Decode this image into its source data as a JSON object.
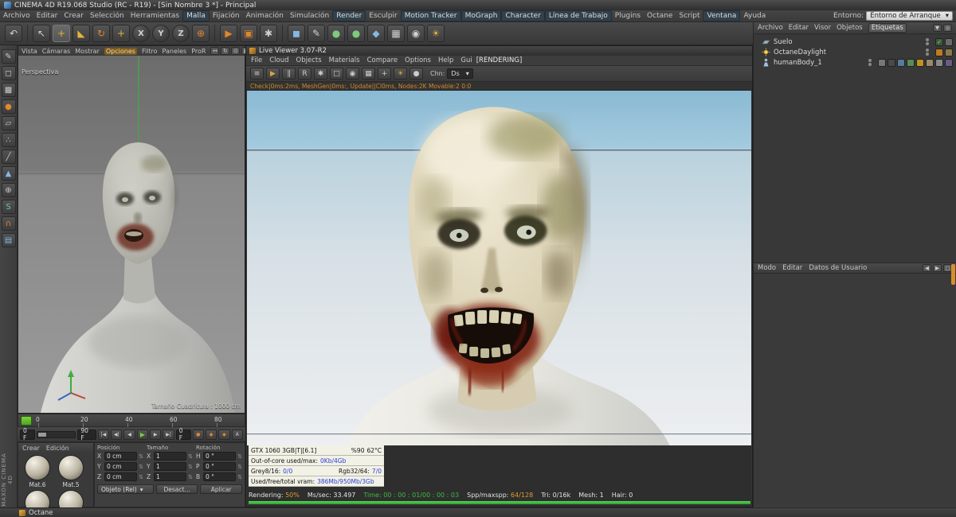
{
  "colors": {
    "accent_orange": "#d98e2b",
    "progress_green": "#2fb344",
    "value_blue": "#2a3fd4",
    "time_green": "#3dbb3d",
    "status_orange": "#cf8a28"
  },
  "title_bar": {
    "app_title": "CINEMA 4D R19.068 Studio (RC - R19) - [Sin Nombre 3 *] - Principal"
  },
  "menu_bar": {
    "items": [
      "Archivo",
      "Editar",
      "Crear",
      "Selección",
      "Herramientas",
      "Malla",
      "Fijación",
      "Animación",
      "Simulación",
      "Render",
      "Esculpir",
      "Motion Tracker",
      "MoGraph",
      "Character",
      "Línea de Trabajo",
      "Plugins",
      "Octane",
      "Script",
      "Ventana",
      "Ayuda"
    ],
    "entorno_label": "Entorno:",
    "entorno_value": "Entorno de Arranque"
  },
  "toolbar": {
    "icons": [
      {
        "name": "undo",
        "glyph": "↶"
      },
      {
        "name": "live-selection",
        "glyph": "↖"
      },
      {
        "name": "move-tool",
        "glyph": "+"
      },
      {
        "name": "scale-tool",
        "glyph": "◣"
      },
      {
        "name": "rotate-tool",
        "glyph": "↻"
      },
      {
        "name": "last-tool",
        "glyph": "+"
      },
      {
        "name": "lock-x",
        "glyph": "X"
      },
      {
        "name": "lock-y",
        "glyph": "Y"
      },
      {
        "name": "lock-z",
        "glyph": "Z"
      },
      {
        "name": "coord-system",
        "glyph": "⊕"
      },
      {
        "name": "render-view",
        "glyph": "▶"
      },
      {
        "name": "render-picture-viewer",
        "glyph": "▣"
      },
      {
        "name": "render-settings",
        "glyph": "✱"
      },
      {
        "name": "add-primitive",
        "glyph": "◼"
      },
      {
        "name": "add-spline",
        "glyph": "✎"
      },
      {
        "name": "add-generator",
        "glyph": "●"
      },
      {
        "name": "add-modeling",
        "glyph": "●"
      },
      {
        "name": "add-deformer",
        "glyph": "◆"
      },
      {
        "name": "add-environment",
        "glyph": "▦"
      },
      {
        "name": "add-camera",
        "glyph": "◉"
      },
      {
        "name": "add-light",
        "glyph": "☀"
      }
    ]
  },
  "left_strip": {
    "icons": [
      {
        "name": "make-editable",
        "glyph": "✎"
      },
      {
        "name": "model-mode",
        "glyph": "◻"
      },
      {
        "name": "texture-mode",
        "glyph": "▩"
      },
      {
        "name": "material-mode",
        "glyph": "●"
      },
      {
        "name": "workplane-mode",
        "glyph": "▱"
      },
      {
        "name": "points-mode",
        "glyph": "∴"
      },
      {
        "name": "edges-mode",
        "glyph": "╱"
      },
      {
        "name": "polygons-mode",
        "glyph": "▲"
      },
      {
        "name": "object-axis-mode",
        "glyph": "⊕"
      },
      {
        "name": "paint-mode",
        "glyph": "S"
      },
      {
        "name": "snap-toggle",
        "glyph": "∩"
      },
      {
        "name": "layers",
        "glyph": "▤"
      }
    ]
  },
  "viewport": {
    "menu_items": [
      "Vista",
      "Cámaras",
      "Mostrar",
      "Opciones",
      "Filtro",
      "Paneles",
      "ProR"
    ],
    "nav_icons": [
      {
        "name": "pan",
        "glyph": "↔"
      },
      {
        "name": "orbit",
        "glyph": "↻"
      },
      {
        "name": "zoom",
        "glyph": "⊙"
      },
      {
        "name": "toggle-view",
        "glyph": "▣"
      }
    ],
    "view_label": "Perspectiva",
    "grid_info": "Tamaño Cuadrícula : 1000 cm"
  },
  "timeline": {
    "ticks": [
      "0",
      "20",
      "40",
      "60",
      "80"
    ],
    "start_frame": "0 F",
    "end_frame": "90 F",
    "current_frame": "0 F",
    "transport_icons": [
      {
        "name": "goto-start",
        "glyph": "|◀"
      },
      {
        "name": "prev-key",
        "glyph": "◀|"
      },
      {
        "name": "prev-frame",
        "glyph": "◀"
      },
      {
        "name": "play",
        "glyph": "▶"
      },
      {
        "name": "next-frame",
        "glyph": "▶"
      },
      {
        "name": "goto-end",
        "glyph": "▶|"
      }
    ],
    "record_icons": [
      {
        "name": "record-keyframe",
        "glyph": "●"
      },
      {
        "name": "record-position",
        "glyph": "◆"
      },
      {
        "name": "record-rotation",
        "glyph": "◆"
      },
      {
        "name": "autokey",
        "glyph": "A"
      }
    ]
  },
  "materials_panel": {
    "menu_items": [
      "Crear",
      "Edición"
    ],
    "materials": [
      {
        "name": "Mat.6"
      },
      {
        "name": "Mat.5"
      },
      {
        "name": ""
      },
      {
        "name": ""
      }
    ]
  },
  "coords_panel": {
    "groups": [
      {
        "label": "Posición",
        "rows": [
          {
            "axis": "X",
            "value": "0 cm"
          },
          {
            "axis": "Y",
            "value": "0 cm"
          },
          {
            "axis": "Z",
            "value": "0 cm"
          }
        ]
      },
      {
        "label": "Tamaño",
        "rows": [
          {
            "axis": "X",
            "value": "1"
          },
          {
            "axis": "Y",
            "value": "1"
          },
          {
            "axis": "Z",
            "value": "1"
          }
        ]
      },
      {
        "label": "Rotación",
        "rows": [
          {
            "axis": "H",
            "value": "0 °"
          },
          {
            "axis": "P",
            "value": "0 °"
          },
          {
            "axis": "B",
            "value": "0 °"
          }
        ]
      }
    ],
    "mode_dropdown": "Objeto (Rel)",
    "buttons": [
      "Desact...",
      "Aplicar"
    ]
  },
  "live_viewer": {
    "window_title": "Live Viewer 3.07-R2",
    "menu_items": [
      "File",
      "Cloud",
      "Objects",
      "Materials",
      "Compare",
      "Options",
      "Help",
      "Gui"
    ],
    "rendering_badge": "[RENDERING]",
    "toolbar_icons": [
      {
        "name": "settings",
        "glyph": "≡"
      },
      {
        "name": "play",
        "glyph": "▶"
      },
      {
        "name": "pause",
        "glyph": "∥"
      },
      {
        "name": "restart",
        "glyph": "R"
      },
      {
        "name": "options",
        "glyph": "✱"
      },
      {
        "name": "lock-resolution",
        "glyph": "□"
      },
      {
        "name": "camera",
        "glyph": "◉"
      },
      {
        "name": "region",
        "glyph": "▦"
      },
      {
        "name": "focus-pick",
        "glyph": "+"
      },
      {
        "name": "light",
        "glyph": "☀"
      },
      {
        "name": "material-pick",
        "glyph": "●"
      }
    ],
    "channel_label": "Chn:",
    "channel_value": "Ds",
    "status_line": "Check|0ms:2ms, MeshGen|0ms:, Update||Cl0ms, Nodes:2K Movable:2 0:0"
  },
  "gpu_panel": {
    "row1": {
      "device": "GTX 1060 3GB|T|[6.1]",
      "load": "%90",
      "temp": "62°C"
    },
    "row2": {
      "label": "Out-of-core used/max:",
      "value": "0Kb/4Gb"
    },
    "row3": {
      "label_a": "Grey8/16:",
      "value_a": "0/0",
      "label_b": "Rgb32/64:",
      "value_b": "7/0"
    },
    "row4": {
      "label": "Used/free/total vram:",
      "value": "386Mb/950Mb/3Gb"
    }
  },
  "render_status": {
    "rendering_label": "Rendering:",
    "rendering_value": "50%",
    "mssec_label": "Ms/sec:",
    "mssec_value": "33.497",
    "time_label": "Time:",
    "time_value": "00 : 00 : 01/00 : 00 : 03",
    "spp_label": "Spp/maxspp:",
    "spp_value": "64/128",
    "tri_label": "Tri:",
    "tri_value": "0/16k",
    "mesh_label": "Mesh:",
    "mesh_value": "1",
    "hair_label": "Hair:",
    "hair_value": "0"
  },
  "object_manager": {
    "menu_items": [
      "Archivo",
      "Editar",
      "Visor",
      "Objetos",
      "Etiquetas"
    ],
    "header_icons": [
      {
        "name": "filter",
        "glyph": "▼"
      },
      {
        "name": "search",
        "glyph": "◎"
      }
    ],
    "objects": [
      {
        "name": "Suelo"
      },
      {
        "name": "OctaneDaylight"
      },
      {
        "name": "humanBody_1"
      }
    ]
  },
  "attribute_manager": {
    "menu_items": [
      "Modo",
      "Editar",
      "Datos de Usuario"
    ],
    "header_icons": [
      {
        "name": "history-back",
        "glyph": "◀"
      },
      {
        "name": "history-forward",
        "glyph": "▶"
      },
      {
        "name": "lock",
        "glyph": "□"
      }
    ]
  },
  "status_bar": {
    "text": "Octane"
  },
  "branding": {
    "left_vertical": "MAXON CINEMA 4D"
  }
}
